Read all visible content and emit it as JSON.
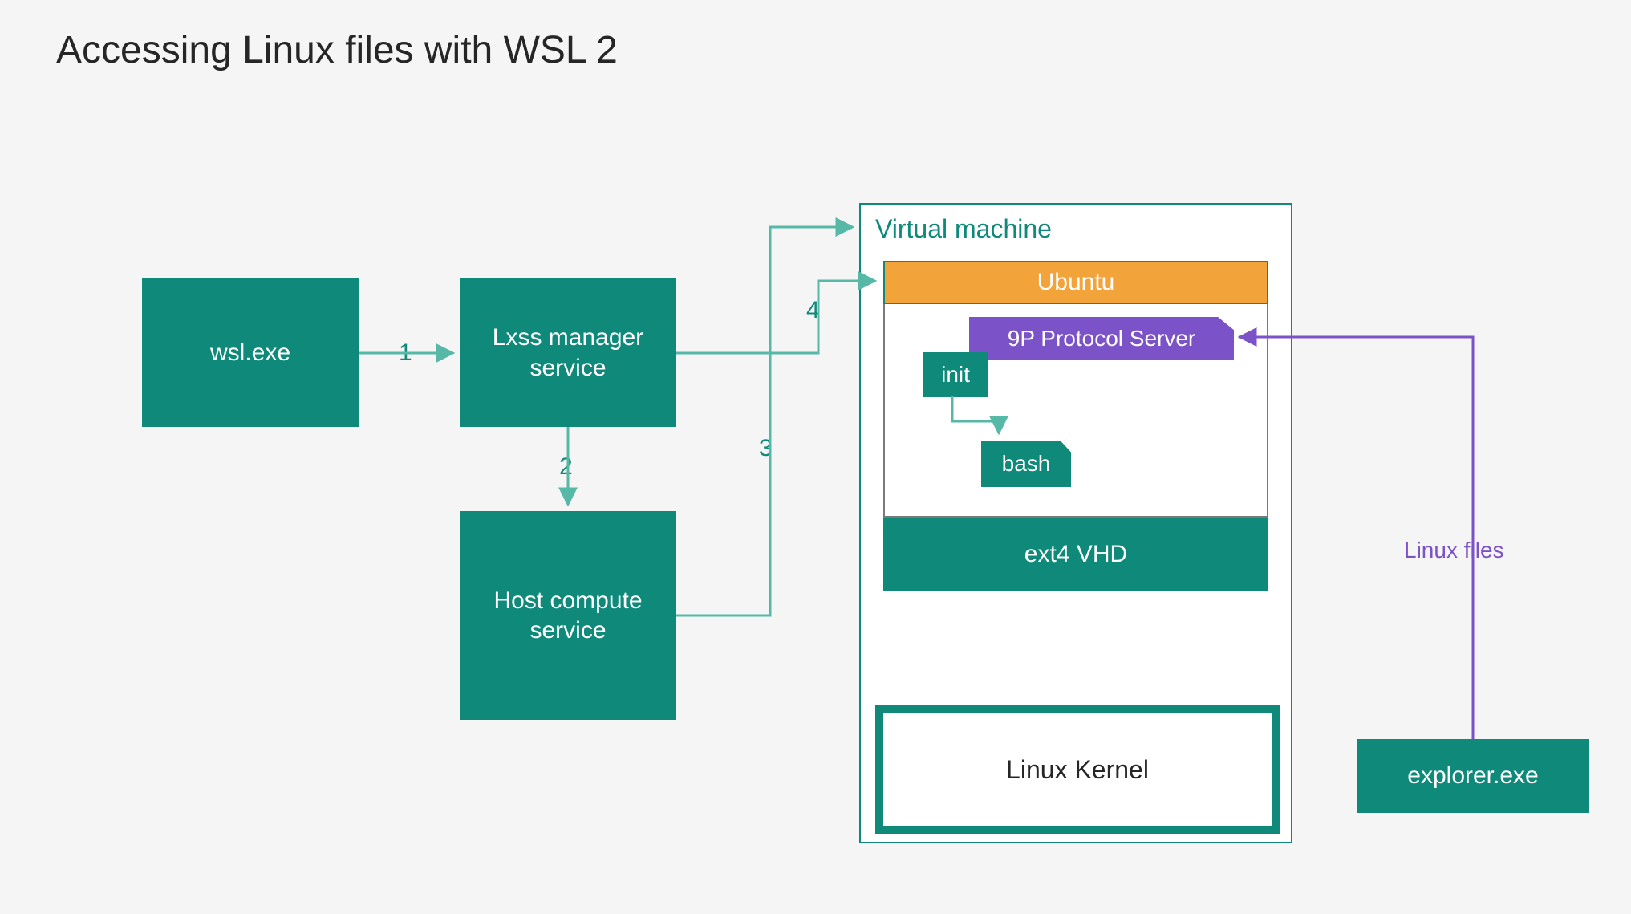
{
  "title": "Accessing Linux files with WSL 2",
  "nodes": {
    "wsl_exe": "wsl.exe",
    "lxss": "Lxss manager\nservice",
    "hcs": "Host compute\nservice",
    "explorer": "explorer.exe"
  },
  "vm": {
    "label": "Virtual machine",
    "distro": "Ubuntu",
    "p9": "9P Protocol Server",
    "init": "init",
    "bash": "bash",
    "ext4": "ext4 VHD",
    "kernel": "Linux Kernel"
  },
  "edges": {
    "n1": "1",
    "n2": "2",
    "n3": "3",
    "n4": "4",
    "linux_files": "Linux files"
  },
  "colors": {
    "teal": "#0f8a7a",
    "orange": "#f2a33a",
    "purple": "#7b52c7",
    "tealLight": "#56b9a8"
  }
}
